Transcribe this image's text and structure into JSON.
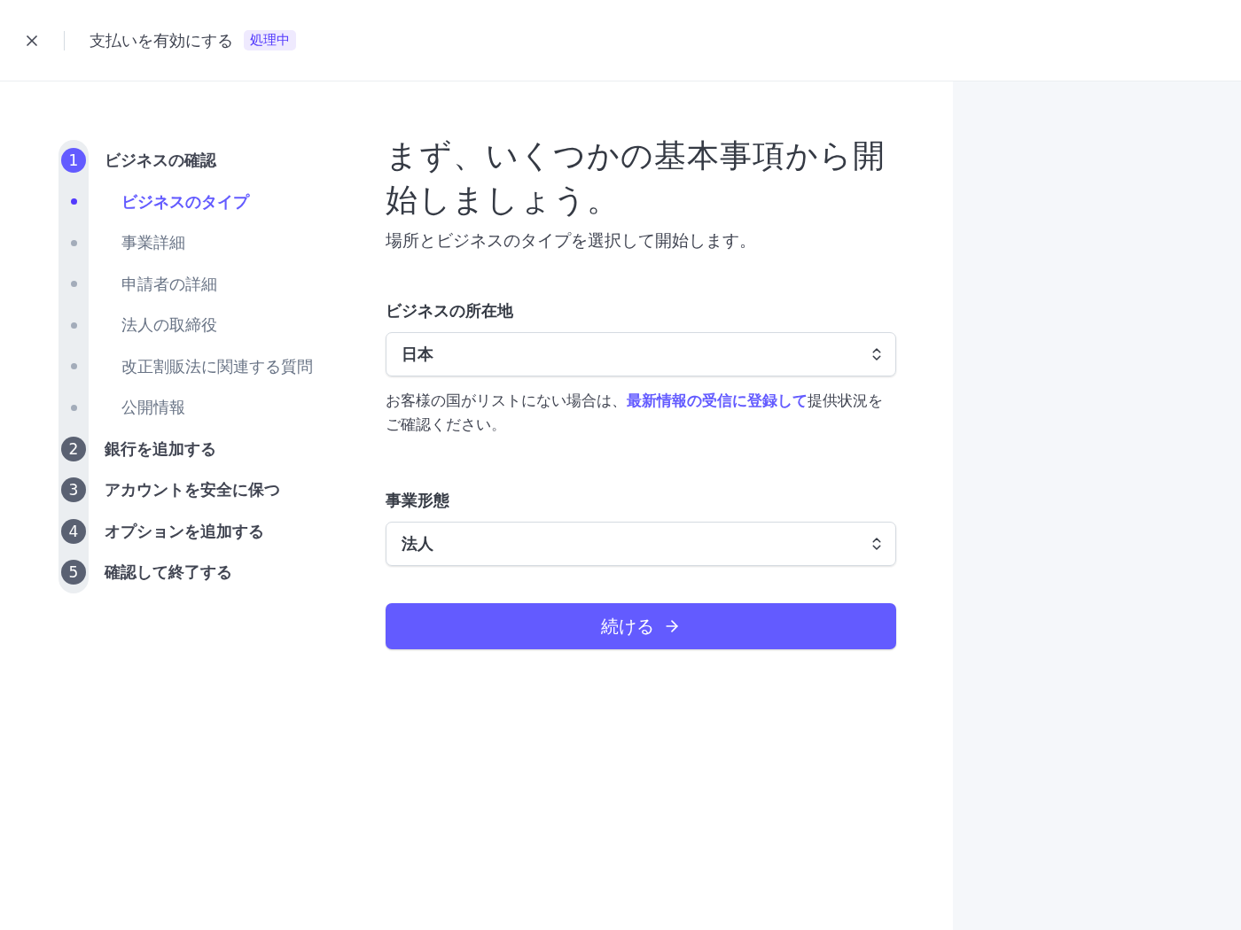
{
  "header": {
    "title": "支払いを有効にする",
    "badge": "処理中"
  },
  "steps": [
    {
      "number": "1",
      "label": "ビジネスの確認",
      "active": true,
      "substeps": [
        {
          "label": "ビジネスのタイプ",
          "selected": true
        },
        {
          "label": "事業詳細",
          "selected": false
        },
        {
          "label": "申請者の詳細",
          "selected": false
        },
        {
          "label": "法人の取締役",
          "selected": false
        },
        {
          "label": "改正割販法に関連する質問",
          "selected": false
        },
        {
          "label": "公開情報",
          "selected": false
        }
      ]
    },
    {
      "number": "2",
      "label": "銀行を追加する",
      "active": false
    },
    {
      "number": "3",
      "label": "アカウントを安全に保つ",
      "active": false
    },
    {
      "number": "4",
      "label": "オプションを追加する",
      "active": false
    },
    {
      "number": "5",
      "label": "確認して終了する",
      "active": false
    }
  ],
  "form": {
    "title": "まず、いくつかの基本事項から開始しましょう。",
    "subtitle": "場所とビジネスのタイプを選択して開始します。",
    "location": {
      "label": "ビジネスの所在地",
      "value": "日本"
    },
    "note": {
      "before": "お客様の国がリストにない場合は、",
      "link": "最新情報の受信に登録して",
      "after": "提供状況をご確認ください。"
    },
    "business_type": {
      "label": "事業形態",
      "value": "法人"
    },
    "submit": "続ける"
  }
}
